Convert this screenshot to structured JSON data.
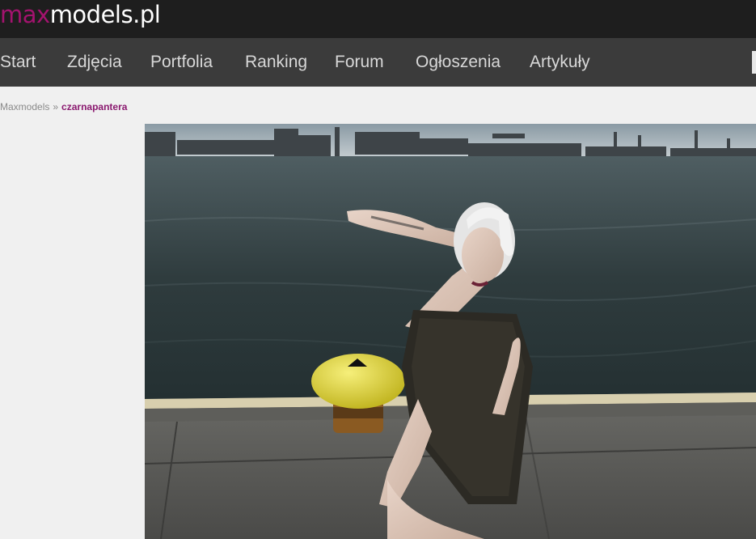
{
  "header": {
    "logo_part1": "max",
    "logo_part2": "models.pl",
    "accent_color": "#a4136f",
    "background_color": "#1e1e1e"
  },
  "nav": {
    "background_color": "#3b3b3b",
    "items": [
      {
        "label": "Start"
      },
      {
        "label": "Zdjęcia"
      },
      {
        "label": "Portfolia"
      },
      {
        "label": "Ranking"
      },
      {
        "label": "Forum"
      },
      {
        "label": "Ogłoszenia"
      },
      {
        "label": "Artykuły"
      }
    ]
  },
  "breadcrumb": {
    "home": "Maxmodels",
    "separator": "»",
    "current": "czarnapantera",
    "current_color": "#8b1a70"
  },
  "photo": {
    "scene": "harbor-portrait-photo"
  }
}
